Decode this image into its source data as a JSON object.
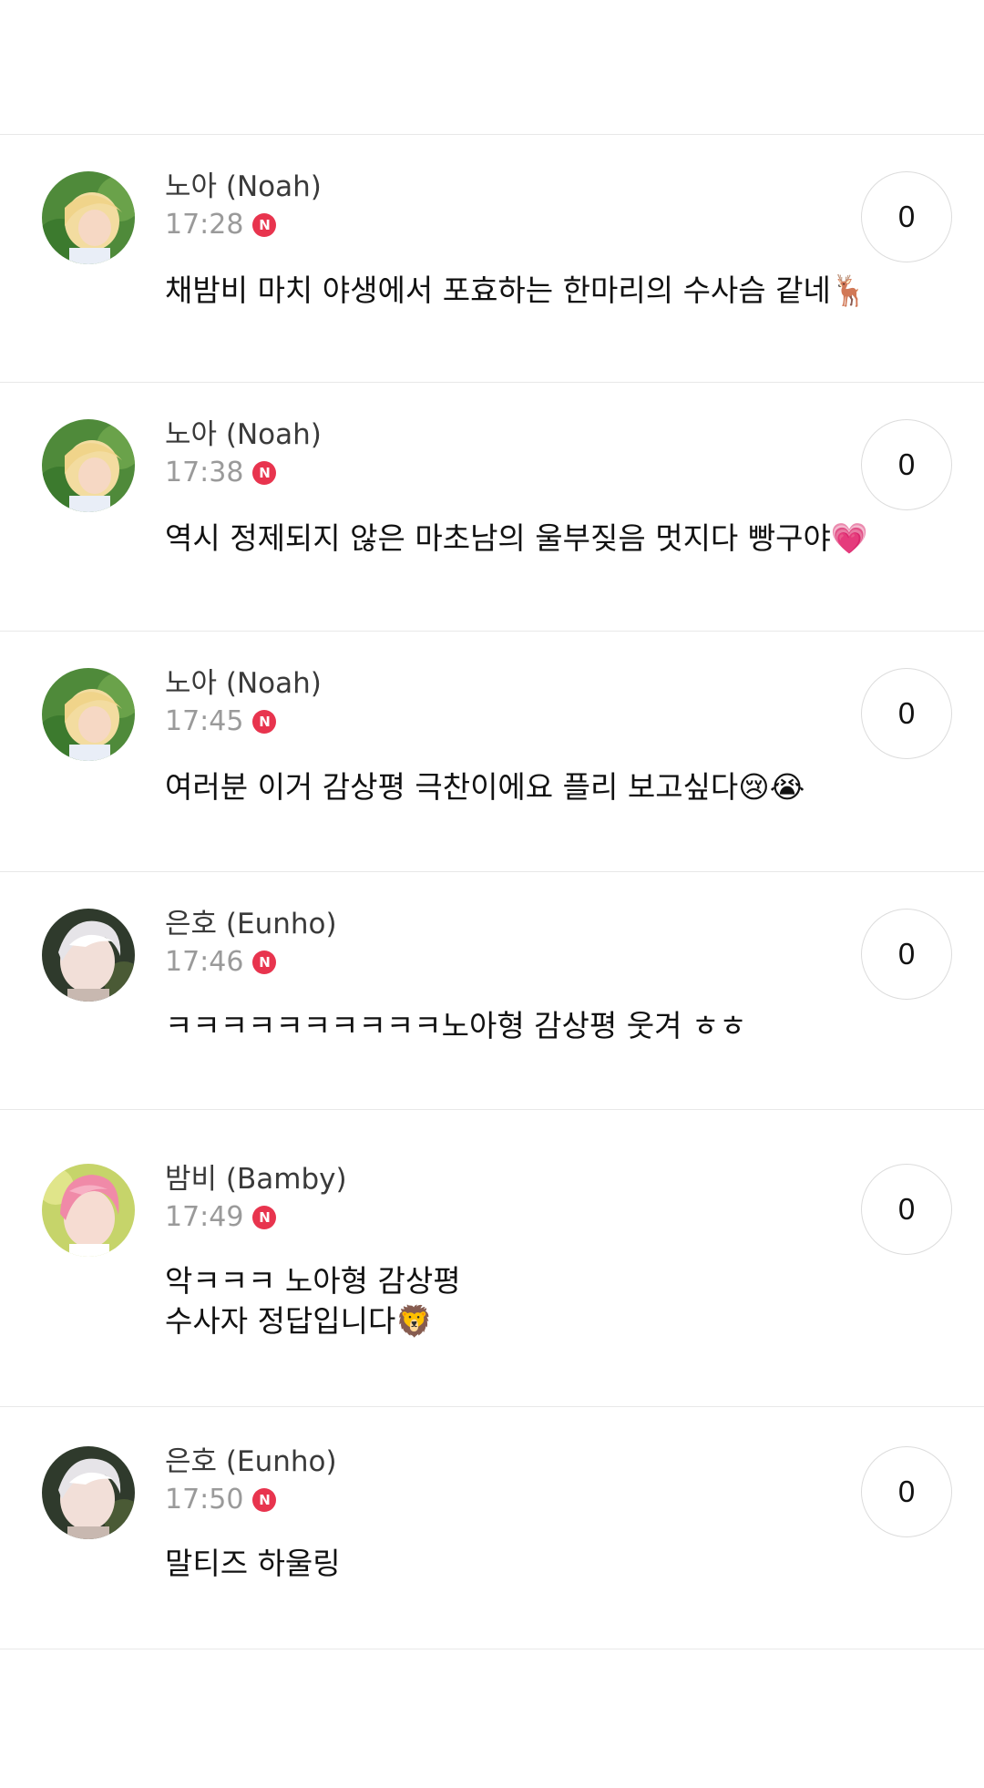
{
  "comments": [
    {
      "author": "노아 (Noah)",
      "time": "17:28",
      "badge": "N",
      "reply_count": "0",
      "lines": [
        "채밤비 마치 야생에서 포효하는 한마리의 수사슴 같네🦌"
      ],
      "avatar": "noah"
    },
    {
      "author": "노아 (Noah)",
      "time": "17:38",
      "badge": "N",
      "reply_count": "0",
      "lines": [
        "역시 정제되지 않은 마초남의 울부짖음 멋지다 빵구야💗"
      ],
      "avatar": "noah"
    },
    {
      "author": "노아 (Noah)",
      "time": "17:45",
      "badge": "N",
      "reply_count": "0",
      "lines": [
        "여러분 이거 감상평 극찬이에요 플리 보고싶다😢😭"
      ],
      "avatar": "noah"
    },
    {
      "author": "은호 (Eunho)",
      "time": "17:46",
      "badge": "N",
      "reply_count": "0",
      "lines": [
        "ㅋㅋㅋㅋㅋㅋㅋㅋㅋㅋ노아형 감상평 웃겨 ㅎㅎ"
      ],
      "avatar": "eunho"
    },
    {
      "author": "밤비 (Bamby)",
      "time": "17:49",
      "badge": "N",
      "reply_count": "0",
      "lines": [
        "악ㅋㅋㅋ 노아형 감상평",
        "수사자 정답입니다🦁"
      ],
      "avatar": "bamby"
    },
    {
      "author": "은호 (Eunho)",
      "time": "17:50",
      "badge": "N",
      "reply_count": "0",
      "lines": [
        "말티즈 하울링"
      ],
      "avatar": "eunho"
    }
  ],
  "colors": {
    "badge": "#e8344e",
    "divider": "#e8e8e8",
    "author": "#3a3a3a",
    "time": "#9a9a9a"
  }
}
